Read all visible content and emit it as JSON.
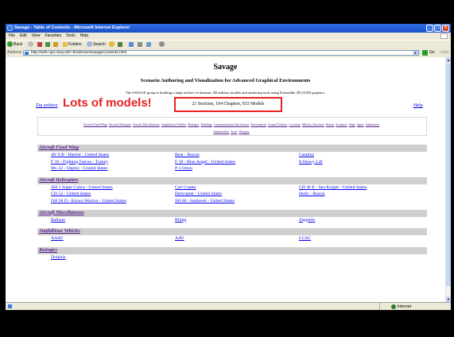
{
  "browser": {
    "title": "Savage - Table of Contents - Microsoft Internet Explorer",
    "menu": [
      "File",
      "Edit",
      "View",
      "Favorites",
      "Tools",
      "Help"
    ],
    "toolbar": {
      "back": "Back",
      "search": "Search",
      "folders": "Folders"
    },
    "address_label": "Address",
    "address": "http://web.nps.navy.mil/~brutzman/Savage/contents.html",
    "go": "Go",
    "links": "Links",
    "status_zone": "Internet"
  },
  "page": {
    "title": "Savage",
    "subtitle": "Scenario Authoring and Visualization for Advanced Graphical Environments",
    "intro": "The SAVAGE group is building a large archive of dynamic 3D military models and authoring tools using Extensible 3D (X3D) graphics.",
    "zip": "Zip archive",
    "help": "Help",
    "callout": "Lots of models!",
    "stats": "21 Sections, 104 Chapters, 833 Models",
    "nav_row1": [
      "Aircraft Fixed Wing",
      "Aircraft Helicopter",
      "Aircraft Miscellaneous",
      "Amphibious Vehicles",
      "Biologics",
      "Buildings",
      "Communications And Sensors",
      "Environment",
      "Ground Vehicles",
      "Locations",
      "Military Structures",
      "Robots",
      "Scenarios",
      "Ships",
      "Space",
      "Submarines"
    ],
    "nav_row2": [
      "Submersibles",
      "Tools",
      "Weapons"
    ],
    "sections": [
      {
        "heading": "Aircraft Fixed Wing",
        "rows": [
          [
            "AV 8 B - Harrier - United States",
            "Bear - Russia",
            "Catalina"
          ],
          [
            "F 16 - Fighting Falcon - Turkey",
            "F 18 - Blue Angel - United States",
            "Il Heavy Lift"
          ],
          [
            "Mv 22 - Osprey - United States",
            "P 3 Orion",
            ""
          ]
        ]
      },
      {
        "heading": "Aircraft Helicopters",
        "rows": [
          [
            "AH 1 Super Cobra - United States",
            "Carl Copter",
            "CH 46 E - Sea Knight - United States"
          ],
          [
            "CH 53 - United States",
            "Helicopter - United States",
            "Helix - Russia"
          ],
          [
            "OH 58 D - Kiowa Warrior - United States",
            "SH 60 - Seahawk - United States",
            ""
          ]
        ]
      },
      {
        "heading": "Aircraft Miscellaneous",
        "rows": [
          [
            "Balloon",
            "Blimp",
            "Zeppelin"
          ]
        ]
      },
      {
        "heading": "Amphibious Vehicles",
        "rows": [
          [
            "AAAV",
            "AAV",
            "LCAC"
          ]
        ]
      },
      {
        "heading": "Biologics",
        "rows": [
          [
            "Dolphin",
            "",
            ""
          ]
        ]
      }
    ]
  },
  "colors": {
    "callout": "#e52222",
    "link": "#0000ee",
    "visited": "#551a8b",
    "section_bg": "#cfcfcf"
  }
}
